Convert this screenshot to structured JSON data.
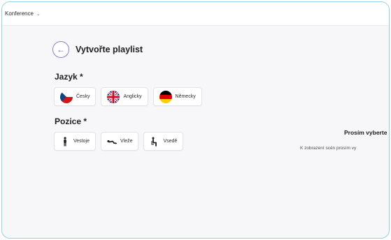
{
  "header": {
    "breadcrumb": "Konference"
  },
  "page": {
    "title": "Vytvořte playlist"
  },
  "language_section": {
    "label": "Jazyk *",
    "options": [
      {
        "label": "Česky",
        "icon": "czech-flag-icon"
      },
      {
        "label": "Anglicky",
        "icon": "uk-flag-icon"
      },
      {
        "label": "Německy",
        "icon": "german-flag-icon"
      }
    ]
  },
  "position_section": {
    "label": "Pozice *",
    "options": [
      {
        "label": "Vestoje",
        "icon": "standing-person-icon"
      },
      {
        "label": "Vleže",
        "icon": "lying-person-icon"
      },
      {
        "label": "Vsedě",
        "icon": "sitting-person-icon"
      }
    ]
  },
  "empty_state": {
    "title": "Prosím vyberte",
    "text": "K zobrazení scén prosím vy"
  },
  "colors": {
    "accent": "#6b5bb8",
    "frame": "#8fd3e6",
    "background": "#f7f7f9"
  }
}
